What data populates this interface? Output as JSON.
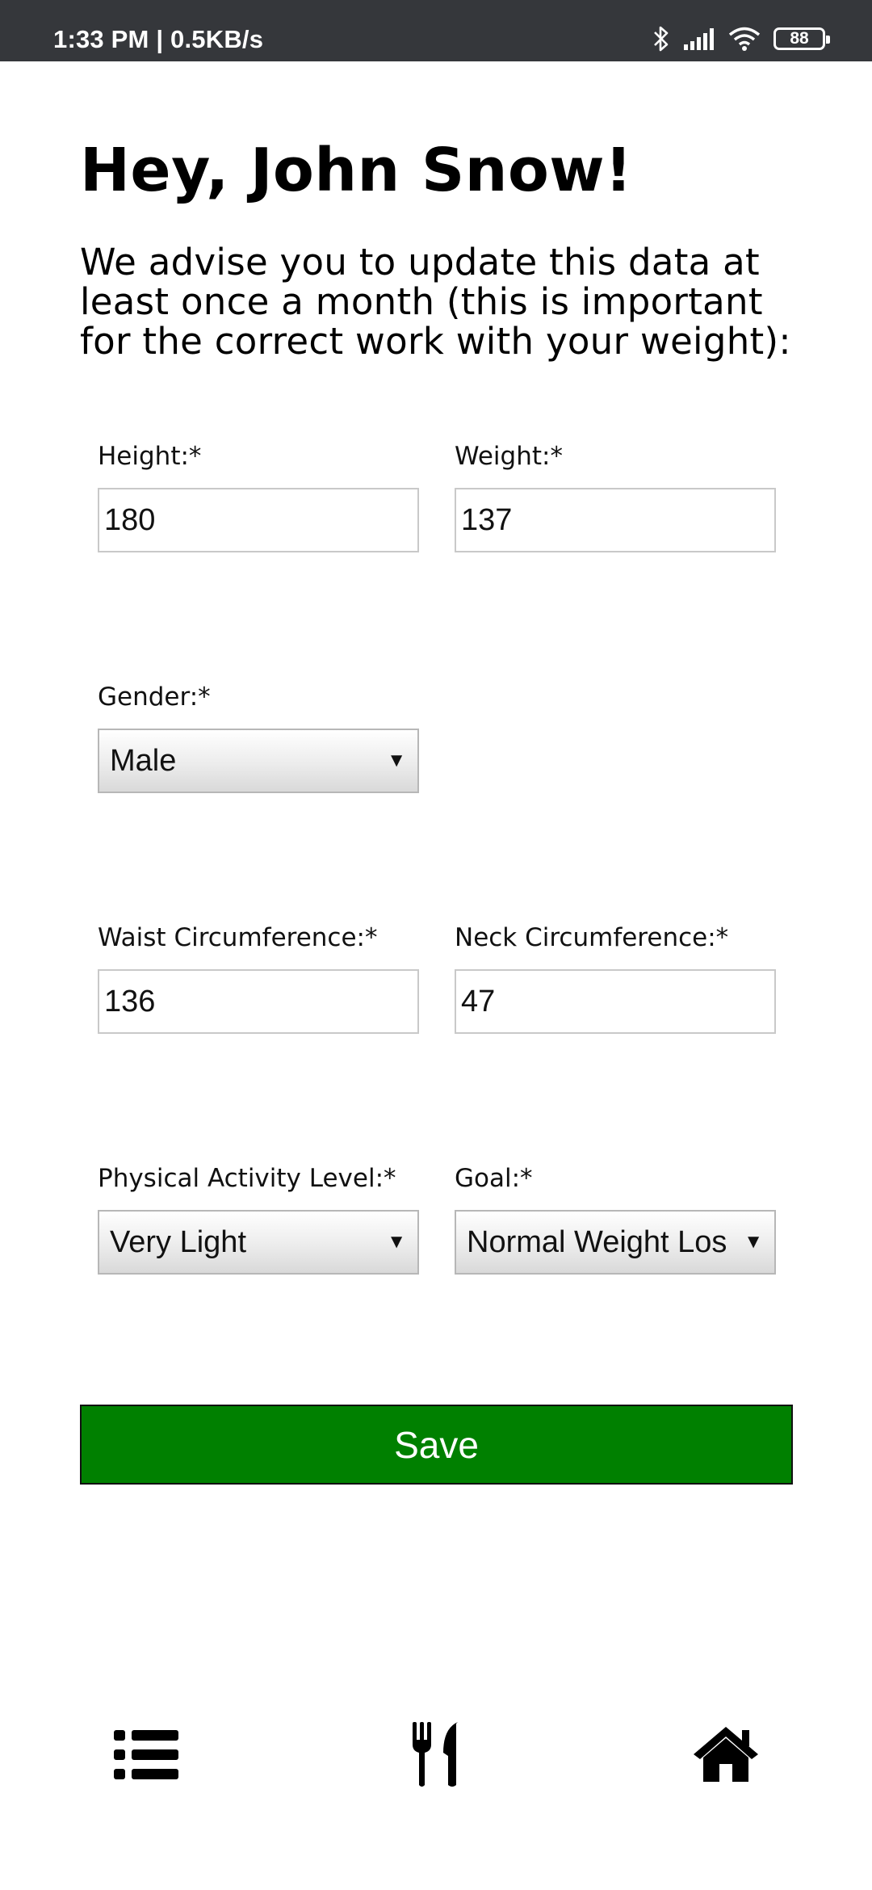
{
  "status_bar": {
    "time": "1:33 PM | 0.5KB/s",
    "battery": "88",
    "icons": [
      "bluetooth-icon",
      "cellular-signal-icon",
      "wifi-icon",
      "battery-icon"
    ]
  },
  "header": {
    "title": "Hey, John Snow!",
    "intro": "We advise you to update this data at least once a month (this is important for the correct work with your weight):"
  },
  "form": {
    "height": {
      "label": "Height:*",
      "value": "180"
    },
    "weight": {
      "label": "Weight:*",
      "value": "137"
    },
    "gender": {
      "label": "Gender:*",
      "value": "Male"
    },
    "waist": {
      "label": "Waist Circumference:*",
      "value": "136"
    },
    "neck": {
      "label": "Neck Circumference:*",
      "value": "47"
    },
    "activity": {
      "label": "Physical Activity Level:*",
      "value": "Very Light"
    },
    "goal": {
      "label": "Goal:*",
      "value": "Normal Weight Los"
    },
    "dropdown_arrow": "▼"
  },
  "save_button": {
    "label": "Save",
    "color": "#008000"
  },
  "bottom_nav": {
    "icons": [
      "list-icon",
      "fork-knife-icon",
      "home-icon"
    ]
  },
  "colors": {
    "status_bar_bg": "#35373b",
    "accent": "#008000"
  }
}
